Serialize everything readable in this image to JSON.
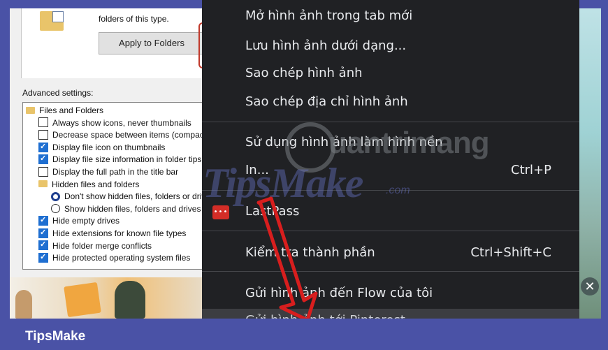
{
  "explorer": {
    "folder_hint": "folders of this type.",
    "apply_button": "Apply to Folders",
    "advanced_label": "Advanced settings:",
    "tree": [
      {
        "kind": "folder",
        "indent": 0,
        "label": "Files and Folders"
      },
      {
        "kind": "checkbox",
        "indent": 1,
        "checked": false,
        "label": "Always show icons, never thumbnails"
      },
      {
        "kind": "checkbox",
        "indent": 1,
        "checked": false,
        "label": "Decrease space between items (compact view)"
      },
      {
        "kind": "checkbox",
        "indent": 1,
        "checked": true,
        "label": "Display file icon on thumbnails"
      },
      {
        "kind": "checkbox",
        "indent": 1,
        "checked": true,
        "label": "Display file size information in folder tips"
      },
      {
        "kind": "checkbox",
        "indent": 1,
        "checked": false,
        "label": "Display the full path in the title bar"
      },
      {
        "kind": "folder",
        "indent": 1,
        "label": "Hidden files and folders"
      },
      {
        "kind": "radio",
        "indent": 2,
        "checked": true,
        "label": "Don't show hidden files, folders or drives"
      },
      {
        "kind": "radio",
        "indent": 2,
        "checked": false,
        "label": "Show hidden files, folders and drives"
      },
      {
        "kind": "checkbox",
        "indent": 1,
        "checked": true,
        "label": "Hide empty drives"
      },
      {
        "kind": "checkbox",
        "indent": 1,
        "checked": true,
        "label": "Hide extensions for known file types"
      },
      {
        "kind": "checkbox",
        "indent": 1,
        "checked": true,
        "label": "Hide folder merge conflicts"
      },
      {
        "kind": "checkbox",
        "indent": 1,
        "checked": true,
        "label": "Hide protected operating system files"
      }
    ]
  },
  "context_menu": {
    "items": [
      {
        "label": "Mở hình ảnh trong tab mới",
        "shortcut": ""
      },
      {
        "label": "Lưu hình ảnh dưới dạng...",
        "shortcut": ""
      },
      {
        "label": "Sao chép hình ảnh",
        "shortcut": ""
      },
      {
        "label": "Sao chép địa chỉ hình ảnh",
        "shortcut": ""
      },
      {
        "label": "Sử dụng hình ảnh làm hình nền",
        "shortcut": ""
      },
      {
        "label": "In...",
        "shortcut": "Ctrl+P"
      },
      {
        "label": "LastPass",
        "shortcut": "",
        "icon": "lastpass-icon"
      },
      {
        "label": "Kiểm tra thành phần",
        "shortcut": "Ctrl+Shift+C"
      },
      {
        "label": "Gửi hình ảnh đến Flow của tôi",
        "shortcut": ""
      },
      {
        "label": "Gửi hình ảnh tới Pinterest",
        "shortcut": ""
      }
    ]
  },
  "watermarks": {
    "quantrimang": "uantrimang",
    "tipsmake": "TipsMake",
    ".com": ".com"
  },
  "footer": {
    "brand": "TipsMake"
  },
  "colors": {
    "frame": "#4a52a6",
    "menu_bg": "#202124",
    "checkbox_on": "#1f6fd1",
    "arrow": "#d81e1e"
  }
}
